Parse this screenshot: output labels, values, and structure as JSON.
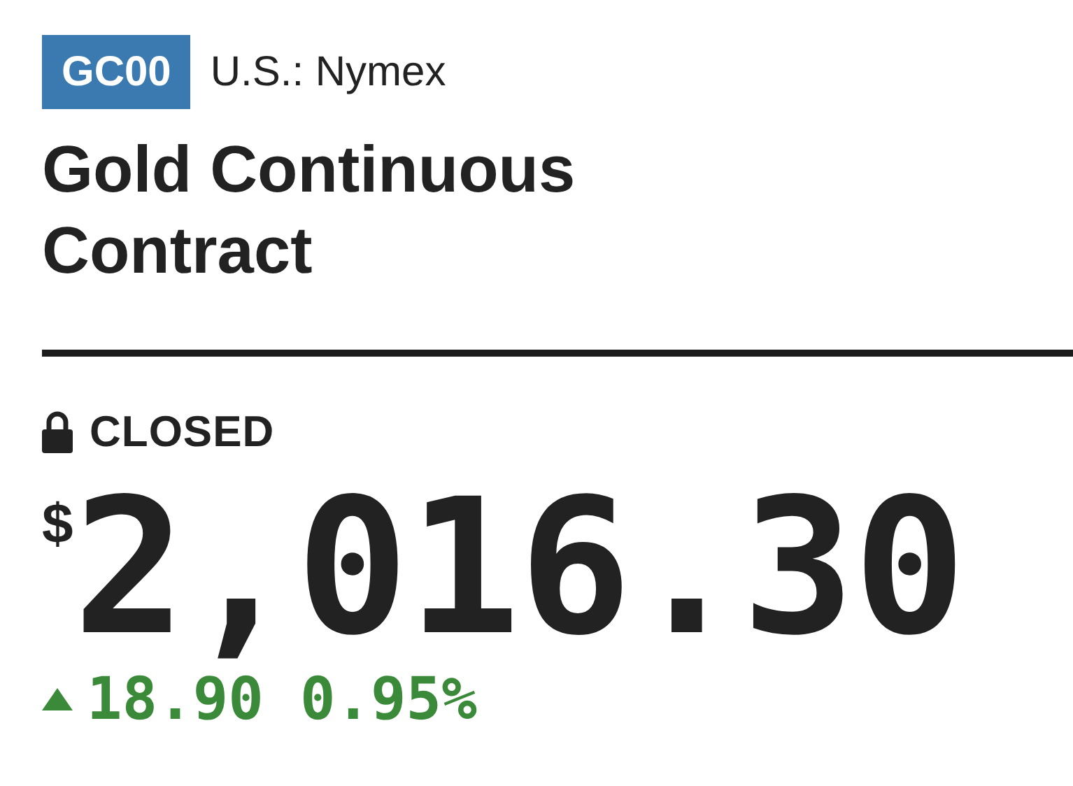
{
  "ticker": "GC00",
  "exchange": "U.S.: Nymex",
  "title": "Gold Continuous Contract",
  "status": {
    "label": "CLOSED",
    "locked": true
  },
  "price": {
    "currency": "$",
    "value": "2,016.30"
  },
  "change": {
    "rising": true,
    "amount": "18.90",
    "percent": "0.95%"
  }
}
